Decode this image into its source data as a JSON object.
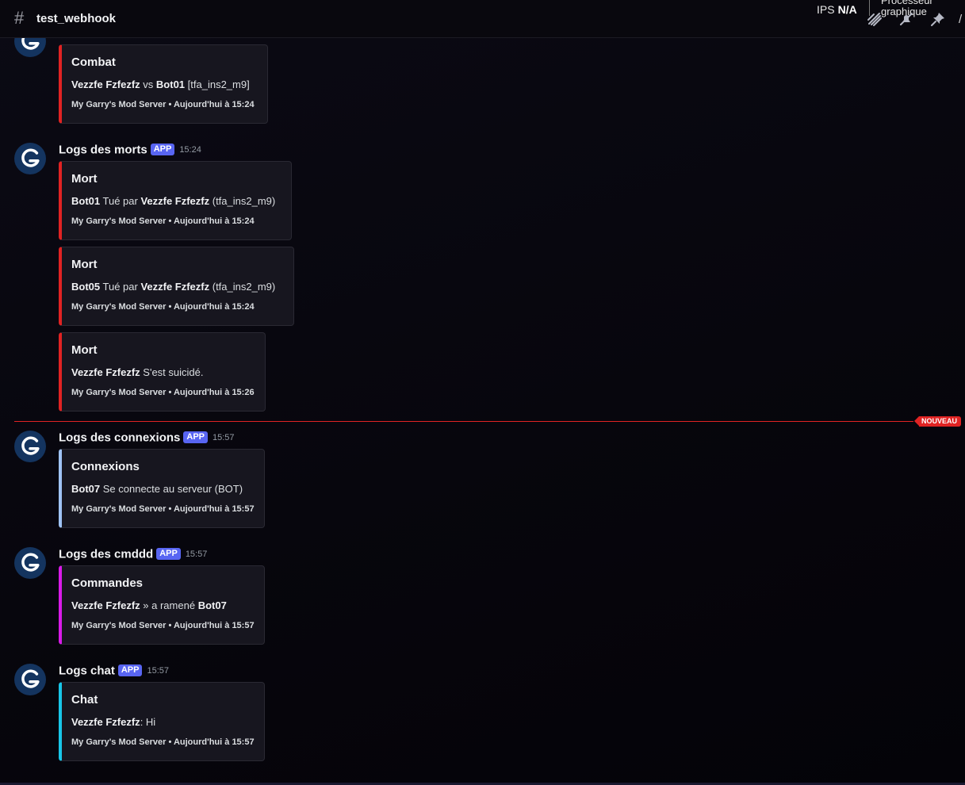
{
  "header": {
    "channel_name": "test_webhook",
    "ips_label": "IPS",
    "ips_value": "N/A",
    "gpu_line1": "Processeur",
    "gpu_line2": "graphique",
    "icons": [
      "threads-icon",
      "notifications-muted-icon",
      "pin-icon"
    ]
  },
  "partial_message": {
    "embed": {
      "title": "Combat",
      "desc_bold1": "Vezzfe Fzfezfz",
      "desc_text1": " vs ",
      "desc_bold2": "Bot01",
      "desc_text2": " [tfa_ins2_m9]",
      "footer": "My Garry's Mod Server • Aujourd'hui à 15:24",
      "accent": "#e02323"
    }
  },
  "new_divider": {
    "label": "NOUVEAU",
    "color": "#e02323"
  },
  "messages": [
    {
      "author": "Logs des morts",
      "badge": "APP",
      "time": "15:24",
      "embeds": [
        {
          "title": "Mort",
          "b1": "Bot01",
          "t1": " Tué par ",
          "b2": "Vezzfe Fzfezfz",
          "t2": " (tfa_ins2_m9)",
          "footer": "My Garry's Mod Server • Aujourd'hui à 15:24",
          "accent": "#e02323"
        },
        {
          "title": "Mort",
          "b1": "Bot05",
          "t1": " Tué par ",
          "b2": "Vezzfe Fzfezfz",
          "t2": " (tfa_ins2_m9)",
          "footer": "My Garry's Mod Server • Aujourd'hui à 15:24",
          "accent": "#e02323"
        },
        {
          "title": "Mort",
          "b1": "Vezzfe Fzfezfz",
          "t1": " S'est suicidé.",
          "footer": "My Garry's Mod Server • Aujourd'hui à 15:26",
          "accent": "#e02323"
        }
      ]
    },
    {
      "author": "Logs des connexions",
      "badge": "APP",
      "time": "15:57",
      "embeds": [
        {
          "title": "Connexions",
          "b1": "Bot07",
          "t1": " Se connecte au serveur (BOT)",
          "footer": "My Garry's Mod Server • Aujourd'hui à 15:57",
          "accent": "#9fc3f5"
        }
      ]
    },
    {
      "author": "Logs des cmddd",
      "badge": "APP",
      "time": "15:57",
      "embeds": [
        {
          "title": "Commandes",
          "b1": "Vezzfe Fzfezfz",
          "t1": " » a ramené ",
          "b2": "Bot07",
          "footer": "My Garry's Mod Server • Aujourd'hui à 15:57",
          "accent": "#d81be8"
        }
      ]
    },
    {
      "author": "Logs chat",
      "badge": "APP",
      "time": "15:57",
      "embeds": [
        {
          "title": "Chat",
          "b1": "Vezzfe Fzfezfz",
          "t1": ": Hi",
          "footer": "My Garry's Mod Server • Aujourd'hui à 15:57",
          "accent": "#18c6e8"
        }
      ]
    }
  ]
}
